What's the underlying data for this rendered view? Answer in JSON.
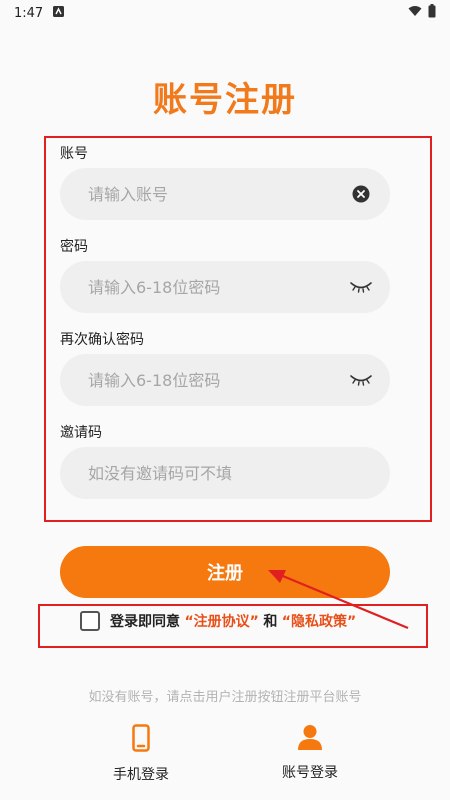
{
  "status_bar": {
    "time": "1:47"
  },
  "page": {
    "title": "账号注册"
  },
  "form": {
    "account_label": "账号",
    "account_placeholder": "请输入账号",
    "password_label": "密码",
    "password_placeholder": "请输入6-18位密码",
    "confirm_label": "再次确认密码",
    "confirm_placeholder": "请输入6-18位密码",
    "invite_label": "邀请码",
    "invite_placeholder": "如没有邀请码可不填"
  },
  "register_button": {
    "label": "注册"
  },
  "agreement": {
    "prefix": "登录即同意",
    "terms_link": "“注册协议”",
    "joiner": "和",
    "privacy_link": "“隐私政策”"
  },
  "hint": "如没有账号，请点击用户注册按钮注册平台账号",
  "bottom_nav": {
    "phone_login": "手机登录",
    "account_login": "账号登录"
  },
  "colors": {
    "accent": "#f5790f",
    "title": "#f07a1c",
    "annotation": "#e02020"
  },
  "icons": [
    "android-notification-icon",
    "wifi-icon",
    "battery-icon",
    "clear-icon",
    "eye-closed-icon",
    "phone-icon",
    "user-icon"
  ]
}
